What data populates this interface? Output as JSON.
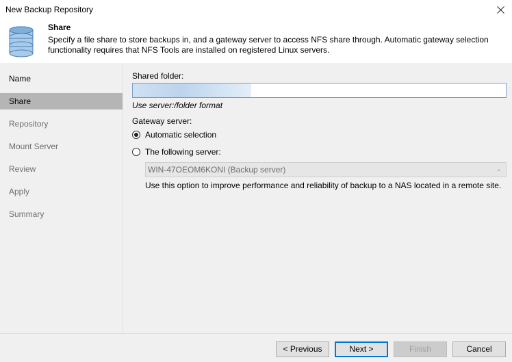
{
  "window": {
    "title": "New Backup Repository",
    "close_icon": "close-icon"
  },
  "header": {
    "title": "Share",
    "description": "Specify a file share to store backups in, and a gateway server to access NFS share through. Automatic gateway selection functionality requires that NFS Tools are installed on registered Linux servers.",
    "icon": "database-icon"
  },
  "steps": [
    {
      "label": "Name",
      "state": "completed"
    },
    {
      "label": "Share",
      "state": "selected"
    },
    {
      "label": "Repository",
      "state": "disabled"
    },
    {
      "label": "Mount Server",
      "state": "disabled"
    },
    {
      "label": "Review",
      "state": "disabled"
    },
    {
      "label": "Apply",
      "state": "disabled"
    },
    {
      "label": "Summary",
      "state": "disabled"
    }
  ],
  "share": {
    "shared_folder_label": "Shared folder:",
    "shared_folder_value": "",
    "format_hint": "Use server:/folder format",
    "gateway_label": "Gateway server:",
    "option_auto": "Automatic selection",
    "option_following": "The following server:",
    "selected_option": "auto",
    "server_value": "WIN-47OEOM6KONI (Backup server)",
    "server_hint": "Use this option to improve performance and reliability of backup to a NAS located in a remote site."
  },
  "footer": {
    "previous_label": "< Previous",
    "next_label": "Next >",
    "finish_label": "Finish",
    "cancel_label": "Cancel"
  }
}
